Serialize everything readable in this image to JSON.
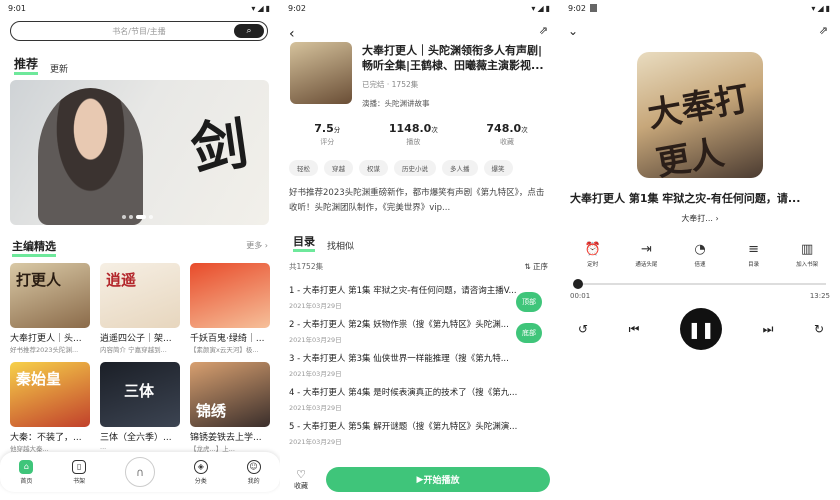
{
  "p1": {
    "status_time": "9:01",
    "search_placeholder": "书名/节目/主播",
    "tabs": [
      "推荐",
      "更新"
    ],
    "section_title": "主编精选",
    "section_more": "更多 ›",
    "cards": [
      {
        "title": "大奉打更人｜头...",
        "sub": "好书推荐2023头陀渊..."
      },
      {
        "title": "逍遥四公子｜架...",
        "sub": "内容简介 宁嘉穿越到..."
      },
      {
        "title": "千妖百鬼·绿绮｜...",
        "sub": "【素颜寅x云天河】极..."
      },
      {
        "title": "大秦：不装了，...",
        "sub": "他穿越大秦..."
      },
      {
        "title": "三体（全六季）...",
        "sub": "..."
      },
      {
        "title": "锦锈姜铁去上学...",
        "sub": "【龙虎...】上..."
      }
    ],
    "cover_labels": [
      "打更人",
      "逍遥",
      "",
      "秦始皇",
      "三体",
      "锦绣"
    ],
    "nav": [
      "首页",
      "书架",
      "",
      "分类",
      "我的"
    ]
  },
  "p2": {
    "status_time": "9:02",
    "title": "大奉打更人｜头陀渊领衔多人有声剧|畅听全集|王鹤棣、田曦薇主演影视...",
    "meta": "已完结 · 1752集",
    "anchor": "演播：头陀渊讲故事",
    "stats": [
      {
        "value": "7.5",
        "unit": "分",
        "label": "评分"
      },
      {
        "value": "1148.0",
        "unit": "次",
        "label": "播放"
      },
      {
        "value": "748.0",
        "unit": "次",
        "label": "收藏"
      }
    ],
    "tags": [
      "轻松",
      "穿越",
      "权谋",
      "历史小说",
      "多人播",
      "爆笑"
    ],
    "intro": "好书推荐2023头陀渊重磅新作，都市爆笑有声剧《第九特区》，点击收听！头陀渊团队制作，《完美世界》vip...",
    "tabs": [
      "目录",
      "找相似"
    ],
    "count": "共1752集",
    "sort": "正序",
    "episodes": [
      {
        "title": "1 - 大奉打更人 第1集 牢狱之灾-有任何问题，请咨询主播V...",
        "date": "2021年03月29日"
      },
      {
        "title": "2 - 大奉打更人 第2集 妖物作祟（搜《第九特区》头陀渊...",
        "date": "2021年03月29日"
      },
      {
        "title": "3 - 大奉打更人 第3集 仙侠世界一样能推理（搜《第九特...",
        "date": "2021年03月29日"
      },
      {
        "title": "4 - 大奉打更人 第4集 是时候表演真正的技术了（搜《第九...",
        "date": "2021年03月29日"
      },
      {
        "title": "5 - 大奉打更人 第5集 解开谜题（搜《第九特区》头陀渊演...",
        "date": "2021年03月29日"
      }
    ],
    "float_top": "顶部",
    "float_bottom": "底部",
    "fav": "收藏",
    "play_all": "开始播放"
  },
  "p3": {
    "status_time": "9:02",
    "cover_text": "大奉打更人",
    "title": "大奉打更人 第1集 牢狱之灾-有任何问题，请...",
    "album": "大奉打... ›",
    "controls": [
      "定时",
      "通话头尾",
      "倍速",
      "目录",
      "加入书架"
    ],
    "time_cur": "00:01",
    "time_total": "13:25",
    "progress": 0.01
  }
}
